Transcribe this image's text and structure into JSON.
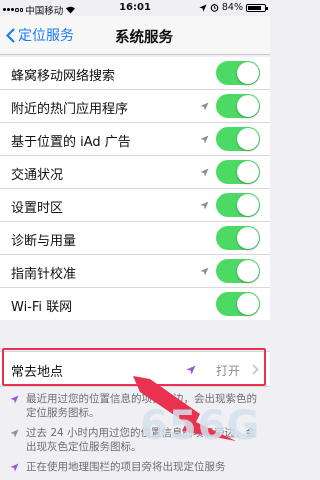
{
  "status_bar": {
    "carrier": "中国移动",
    "time": "16:01",
    "battery": "84%",
    "battery_level": 0.84
  },
  "nav": {
    "back_label": "定位服务",
    "title": "系统服务"
  },
  "rows": [
    {
      "label": "蜂窝移动网络搜索",
      "arrow": false,
      "on": true
    },
    {
      "label": "附近的热门应用程序",
      "arrow": true,
      "on": true
    },
    {
      "label": "基于位置的 iAd 广告",
      "arrow": true,
      "on": true
    },
    {
      "label": "交通状况",
      "arrow": true,
      "on": true
    },
    {
      "label": "设置时区",
      "arrow": true,
      "on": true
    },
    {
      "label": "诊断与用量",
      "arrow": false,
      "on": true
    },
    {
      "label": "指南针校准",
      "arrow": true,
      "on": true
    },
    {
      "label": "Wi-Fi 联网",
      "arrow": false,
      "on": true
    }
  ],
  "frequent_locations": {
    "label": "常去地点",
    "value": "打开"
  },
  "notes": [
    {
      "text": "最近用过您的位置信息的项目旁边，会出现紫色的定位服务图标。",
      "icon_color": "#9b59d0"
    },
    {
      "text": "过去 24 小时内用过您的位置信息的项目旁边，会出现灰色定位服务图标。",
      "icon_color": "#8e8e93"
    },
    {
      "text": "正在使用地理围栏的项目旁将出现定位服务",
      "icon_color": "#9b59d0"
    }
  ],
  "watermark": "656G",
  "colors": {
    "accent": "#1a7cf8",
    "toggle_on": "#4cd964",
    "highlight": "#e8324f"
  }
}
